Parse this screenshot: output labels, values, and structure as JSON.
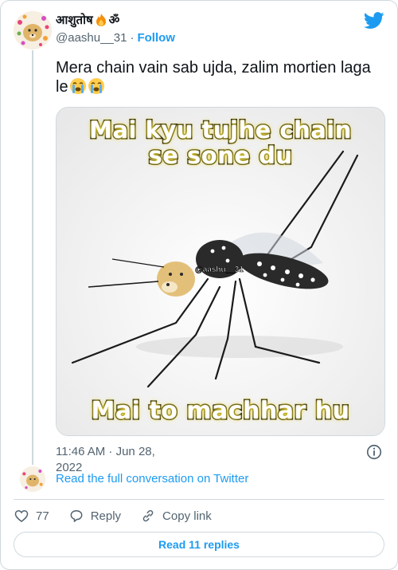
{
  "author": {
    "display_name": "आशुतोष",
    "name_suffix": "ॐ",
    "handle": "@aashu__31",
    "follow_label": "Follow"
  },
  "tweet": {
    "text": "Mera chain vain sab ujda, zalim mortien laga le"
  },
  "media": {
    "top_caption_line1": "Mai kyu tujhe chain",
    "top_caption_line2": "se sone du",
    "bottom_caption": "Mai to machhar hu",
    "watermark": "@aashu__31"
  },
  "meta": {
    "timestamp": "11:46 AM · Jun 28, 2022",
    "read_full_label": "Read the full conversation on Twitter"
  },
  "actions": {
    "like_count": "77",
    "reply_label": "Reply",
    "copy_label": "Copy link"
  },
  "replies_button": "Read 11 replies",
  "colors": {
    "accent": "#1d9bf0",
    "secondary_text": "#536471",
    "border": "#cfd9de"
  },
  "icons": [
    "avatar",
    "fire-icon",
    "twitter-logo-icon",
    "loudly-crying-face-icon",
    "info-icon",
    "heart-icon",
    "reply-icon",
    "link-icon"
  ]
}
